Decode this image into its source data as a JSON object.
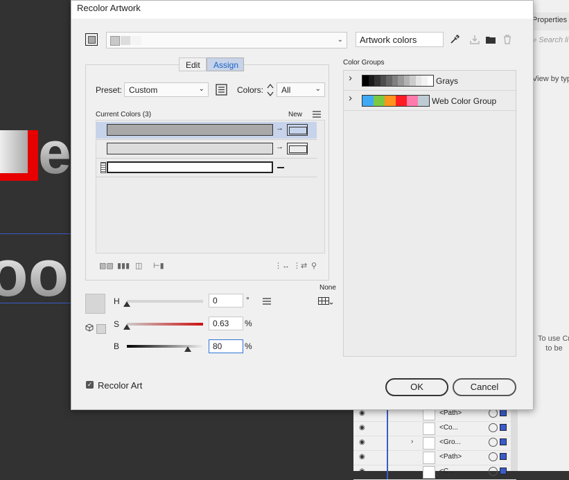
{
  "dialog": {
    "title": "Recolor Artwork",
    "artwork_colors_value": "Artwork colors",
    "tabs": [
      {
        "label": "Edit",
        "active": false
      },
      {
        "label": "Assign",
        "active": true
      }
    ],
    "preset_label": "Preset:",
    "preset_value": "Custom",
    "colors_label": "Colors:",
    "colors_value": "All",
    "current_colors_label": "Current Colors (3)",
    "new_label": "New",
    "current_colors": [
      {
        "color": "#a9a9a9",
        "selected": true,
        "has_new": true
      },
      {
        "color": "#dcdcdc",
        "selected": false,
        "has_new": true
      },
      {
        "color": "#ffffff",
        "selected": false,
        "has_new": false
      }
    ],
    "none_label": "None",
    "hsb": {
      "h_label": "H",
      "h_value": "0",
      "h_unit": "°",
      "s_label": "S",
      "s_value": "0.63",
      "s_unit": "%",
      "b_label": "B",
      "b_value": "80",
      "b_unit": "%"
    },
    "recolor_art_label": "Recolor Art",
    "recolor_art_checked": true,
    "ok_label": "OK",
    "cancel_label": "Cancel"
  },
  "color_groups": {
    "header": "Color Groups",
    "groups": [
      {
        "name": "Grays",
        "swatches": [
          "#000000",
          "#1a1a1a",
          "#333333",
          "#4d4d4d",
          "#666666",
          "#808080",
          "#999999",
          "#b3b3b3",
          "#cccccc",
          "#e6e6e6",
          "#f2f2f2",
          "#ffffff"
        ]
      },
      {
        "name": "Web Color Group",
        "swatches": [
          "#3fa9f5",
          "#7ac943",
          "#ff931e",
          "#ff1d25",
          "#ff7bac",
          "#bdccd4"
        ]
      }
    ]
  },
  "right_panel": {
    "tab": "Properties",
    "search_placeholder": "Search li",
    "view_by": "View by typ",
    "note_line1": "To use Cr",
    "note_line2": "to be"
  },
  "layers": [
    {
      "name": "<Path>",
      "expandable": false
    },
    {
      "name": "<Co...",
      "expandable": false
    },
    {
      "name": "<Gro...",
      "expandable": true
    },
    {
      "name": "<Path>",
      "expandable": false
    },
    {
      "name": "<C...",
      "expandable": false
    }
  ],
  "colors": {
    "accent": "#1a63c7",
    "selection": "#c6d3ea",
    "saturation_red": "#cc1111"
  }
}
